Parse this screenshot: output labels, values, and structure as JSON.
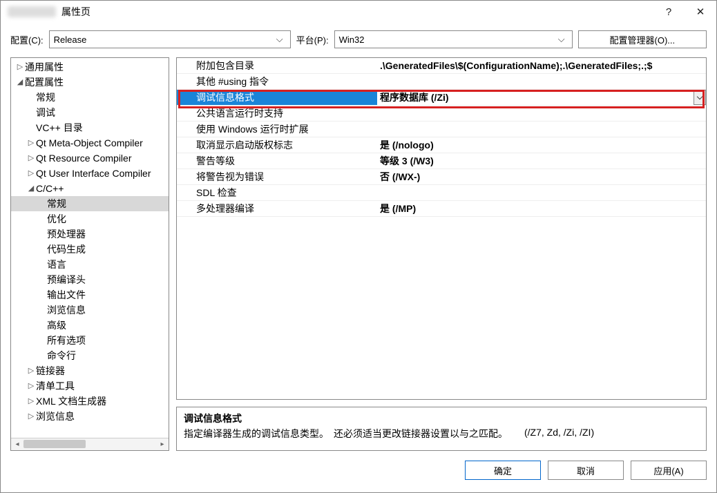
{
  "window": {
    "title": "属性页",
    "help_icon": "?",
    "close_icon": "✕"
  },
  "toolbar": {
    "config_label": "配置(C):",
    "config_value": "Release",
    "platform_label": "平台(P):",
    "platform_value": "Win32",
    "manager_button": "配置管理器(O)..."
  },
  "tree": [
    {
      "label": "通用属性",
      "indent": 0,
      "twisty": "▷"
    },
    {
      "label": "配置属性",
      "indent": 0,
      "twisty": "◢"
    },
    {
      "label": "常规",
      "indent": 1,
      "twisty": ""
    },
    {
      "label": "调试",
      "indent": 1,
      "twisty": ""
    },
    {
      "label": "VC++ 目录",
      "indent": 1,
      "twisty": ""
    },
    {
      "label": "Qt Meta-Object Compiler",
      "indent": 1,
      "twisty": "▷"
    },
    {
      "label": "Qt Resource Compiler",
      "indent": 1,
      "twisty": "▷"
    },
    {
      "label": "Qt User Interface Compiler",
      "indent": 1,
      "twisty": "▷"
    },
    {
      "label": "C/C++",
      "indent": 1,
      "twisty": "◢"
    },
    {
      "label": "常规",
      "indent": 2,
      "twisty": "",
      "selected": true
    },
    {
      "label": "优化",
      "indent": 2,
      "twisty": ""
    },
    {
      "label": "预处理器",
      "indent": 2,
      "twisty": ""
    },
    {
      "label": "代码生成",
      "indent": 2,
      "twisty": ""
    },
    {
      "label": "语言",
      "indent": 2,
      "twisty": ""
    },
    {
      "label": "预编译头",
      "indent": 2,
      "twisty": ""
    },
    {
      "label": "输出文件",
      "indent": 2,
      "twisty": ""
    },
    {
      "label": "浏览信息",
      "indent": 2,
      "twisty": ""
    },
    {
      "label": "高级",
      "indent": 2,
      "twisty": ""
    },
    {
      "label": "所有选项",
      "indent": 2,
      "twisty": ""
    },
    {
      "label": "命令行",
      "indent": 2,
      "twisty": ""
    },
    {
      "label": "链接器",
      "indent": 1,
      "twisty": "▷"
    },
    {
      "label": "清单工具",
      "indent": 1,
      "twisty": "▷"
    },
    {
      "label": "XML 文档生成器",
      "indent": 1,
      "twisty": "▷"
    },
    {
      "label": "浏览信息",
      "indent": 1,
      "twisty": "▷"
    }
  ],
  "props": [
    {
      "name": "附加包含目录",
      "value": ".\\GeneratedFiles\\$(ConfigurationName);.\\GeneratedFiles;.;$"
    },
    {
      "name": "其他 #using 指令",
      "value": ""
    },
    {
      "name": "调试信息格式",
      "value": "程序数据库 (/Zi)",
      "active": true
    },
    {
      "name": "公共语言运行时支持",
      "value": ""
    },
    {
      "name": "使用 Windows 运行时扩展",
      "value": ""
    },
    {
      "name": "取消显示启动版权标志",
      "value": "是 (/nologo)"
    },
    {
      "name": "警告等级",
      "value": "等级 3 (/W3)"
    },
    {
      "name": "将警告视为错误",
      "value": "否 (/WX-)"
    },
    {
      "name": "SDL 检查",
      "value": ""
    },
    {
      "name": "多处理器编译",
      "value": "是 (/MP)"
    }
  ],
  "description": {
    "title": "调试信息格式",
    "body1": "指定编译器生成的调试信息类型。　还必须适当更改链接器设置以与之匹配。",
    "body2": "(/Z7, Zd, /Zi, /ZI)"
  },
  "footer": {
    "ok": "确定",
    "cancel": "取消",
    "apply": "应用(A)"
  }
}
